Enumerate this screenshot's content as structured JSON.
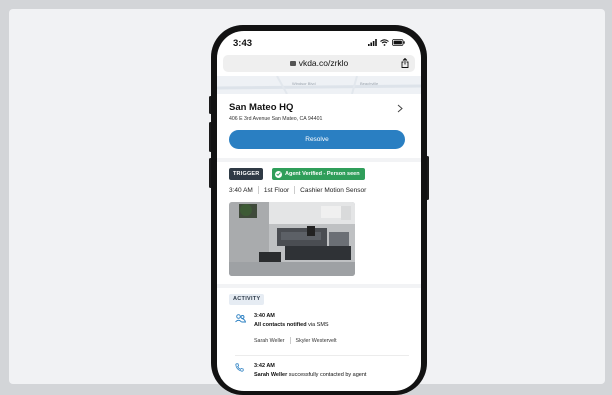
{
  "browser": {
    "time": "3:43",
    "url": "vkda.co/zrklo"
  },
  "map": {
    "labels": [
      "Windsor Blvd",
      "Beachville"
    ]
  },
  "location": {
    "name": "San Mateo HQ",
    "address": "406 E 3rd Avenue San Mateo, CA 94401"
  },
  "resolve_label": "Resolve",
  "alert": {
    "trigger_label": "TRIGGER",
    "verified_label": "Agent Verified - Person seen",
    "time": "3:40 AM",
    "floor": "1st Floor",
    "camera": "Cashier Motion Sensor"
  },
  "activity": {
    "heading": "ACTIVITY",
    "events": [
      {
        "icon": "contacts-icon",
        "time": "3:40 AM",
        "desc_bold": "All contacts notified",
        "desc_rest": " via SMS",
        "names": [
          "Sarah Weller",
          "Skyler Westervelt"
        ]
      },
      {
        "icon": "phone-icon",
        "time": "3:42 AM",
        "desc_bold": "Sarah Weller",
        "desc_rest": " successfully contacted by agent"
      }
    ]
  },
  "colors": {
    "primary": "#2a7fc2",
    "verified": "#2f9e5a",
    "trigger": "#2f3a45"
  }
}
